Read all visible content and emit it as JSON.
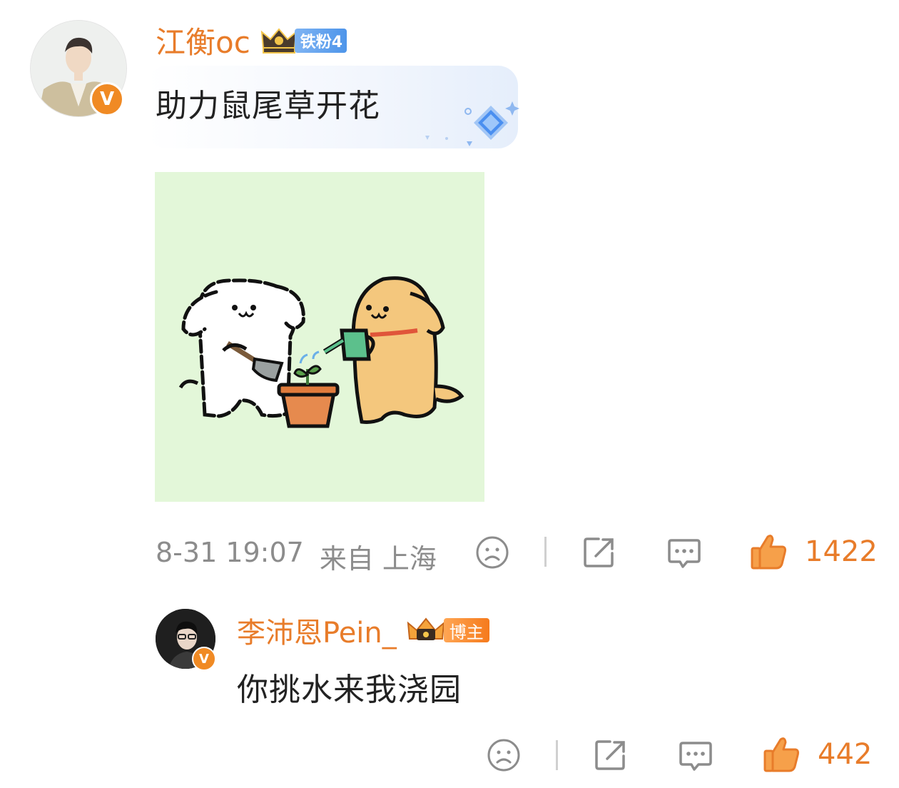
{
  "comment": {
    "username": "江衡oc",
    "fan_badge": "铁粉4",
    "text": "助力鼠尾草开花",
    "time": "8-31 19:07",
    "location": "来自 上海",
    "likes": "1422"
  },
  "reply": {
    "username": "李沛恩Pein_",
    "host_badge": "博主",
    "text": "你挑水来我浇园",
    "likes": "442"
  },
  "icons": {
    "sad": "sad-face-icon",
    "share": "share-icon",
    "comment": "comment-icon",
    "like": "thumbs-up-icon",
    "verified": "verified-v-icon"
  },
  "colors": {
    "accent": "#e87c2a",
    "meta": "#8c8c8c",
    "image_bg": "#e2f7d8"
  }
}
